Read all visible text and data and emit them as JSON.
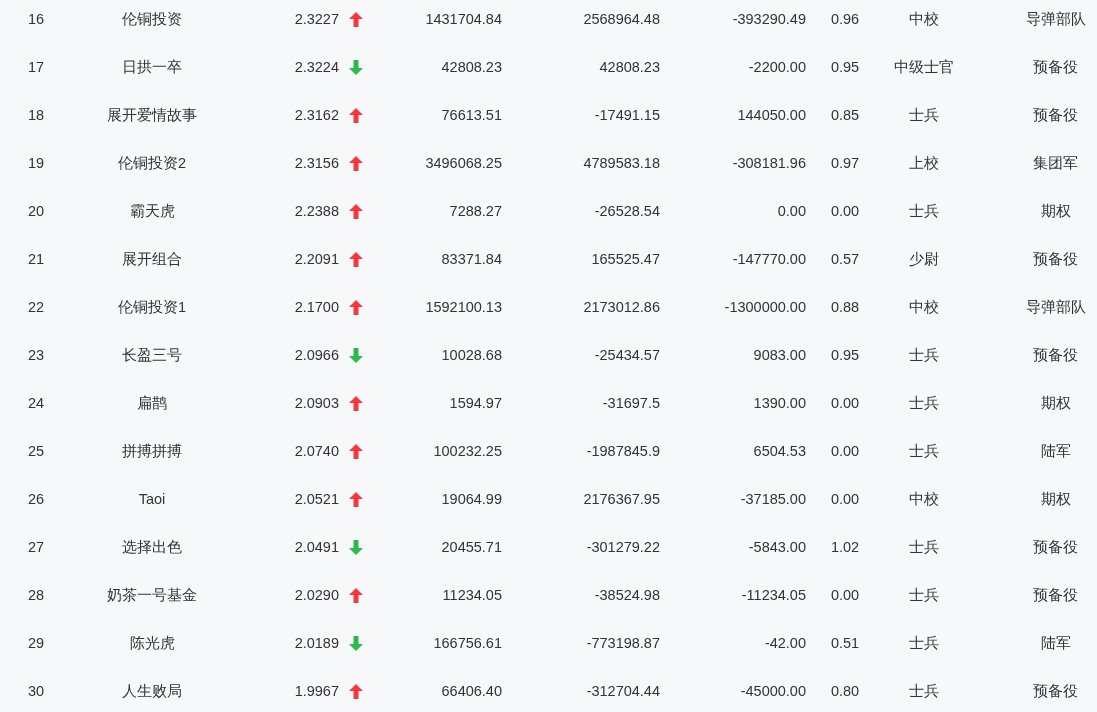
{
  "table": {
    "rows": [
      {
        "cells": [
          "16",
          "伦铜投资",
          "2.3227",
          "1431704.84",
          "2568964.48",
          "-393290.49",
          "0.96",
          "中校",
          "导弹部队"
        ],
        "rising": true
      },
      {
        "cells": [
          "17",
          "日拱一卒",
          "2.3224",
          "42808.23",
          "42808.23",
          "-2200.00",
          "0.95",
          "中级士官",
          "预备役"
        ],
        "rising": false
      },
      {
        "cells": [
          "18",
          "展开爱情故事",
          "2.3162",
          "76613.51",
          "-17491.15",
          "144050.00",
          "0.85",
          "士兵",
          "预备役"
        ],
        "rising": true
      },
      {
        "cells": [
          "19",
          "伦铜投资2",
          "2.3156",
          "3496068.25",
          "4789583.18",
          "-308181.96",
          "0.97",
          "上校",
          "集团军"
        ],
        "rising": true
      },
      {
        "cells": [
          "20",
          "霸天虎",
          "2.2388",
          "7288.27",
          "-26528.54",
          "0.00",
          "0.00",
          "士兵",
          "期权"
        ],
        "rising": true
      },
      {
        "cells": [
          "21",
          "展开组合",
          "2.2091",
          "83371.84",
          "165525.47",
          "-147770.00",
          "0.57",
          "少尉",
          "预备役"
        ],
        "rising": true
      },
      {
        "cells": [
          "22",
          "伦铜投资1",
          "2.1700",
          "1592100.13",
          "2173012.86",
          "-1300000.00",
          "0.88",
          "中校",
          "导弹部队"
        ],
        "rising": true
      },
      {
        "cells": [
          "23",
          "长盈三号",
          "2.0966",
          "10028.68",
          "-25434.57",
          "9083.00",
          "0.95",
          "士兵",
          "预备役"
        ],
        "rising": false
      },
      {
        "cells": [
          "24",
          "扁鹊",
          "2.0903",
          "1594.97",
          "-31697.5",
          "1390.00",
          "0.00",
          "士兵",
          "期权"
        ],
        "rising": true
      },
      {
        "cells": [
          "25",
          "拼搏拼搏",
          "2.0740",
          "100232.25",
          "-1987845.9",
          "6504.53",
          "0.00",
          "士兵",
          "陆军"
        ],
        "rising": true
      },
      {
        "cells": [
          "26",
          "Taoi",
          "2.0521",
          "19064.99",
          "2176367.95",
          "-37185.00",
          "0.00",
          "中校",
          "期权"
        ],
        "rising": true
      },
      {
        "cells": [
          "27",
          "选择出色",
          "2.0491",
          "20455.71",
          "-301279.22",
          "-5843.00",
          "1.02",
          "士兵",
          "预备役"
        ],
        "rising": false
      },
      {
        "cells": [
          "28",
          "奶茶一号基金",
          "2.0290",
          "11234.05",
          "-38524.98",
          "-11234.05",
          "0.00",
          "士兵",
          "预备役"
        ],
        "rising": true
      },
      {
        "cells": [
          "29",
          "陈光虎",
          "2.0189",
          "166756.61",
          "-773198.87",
          "-42.00",
          "0.51",
          "士兵",
          "陆军"
        ],
        "rising": false
      },
      {
        "cells": [
          "30",
          "人生败局",
          "1.9967",
          "66406.40",
          "-312704.44",
          "-45000.00",
          "0.80",
          "士兵",
          "预备役"
        ],
        "rising": true
      }
    ]
  }
}
